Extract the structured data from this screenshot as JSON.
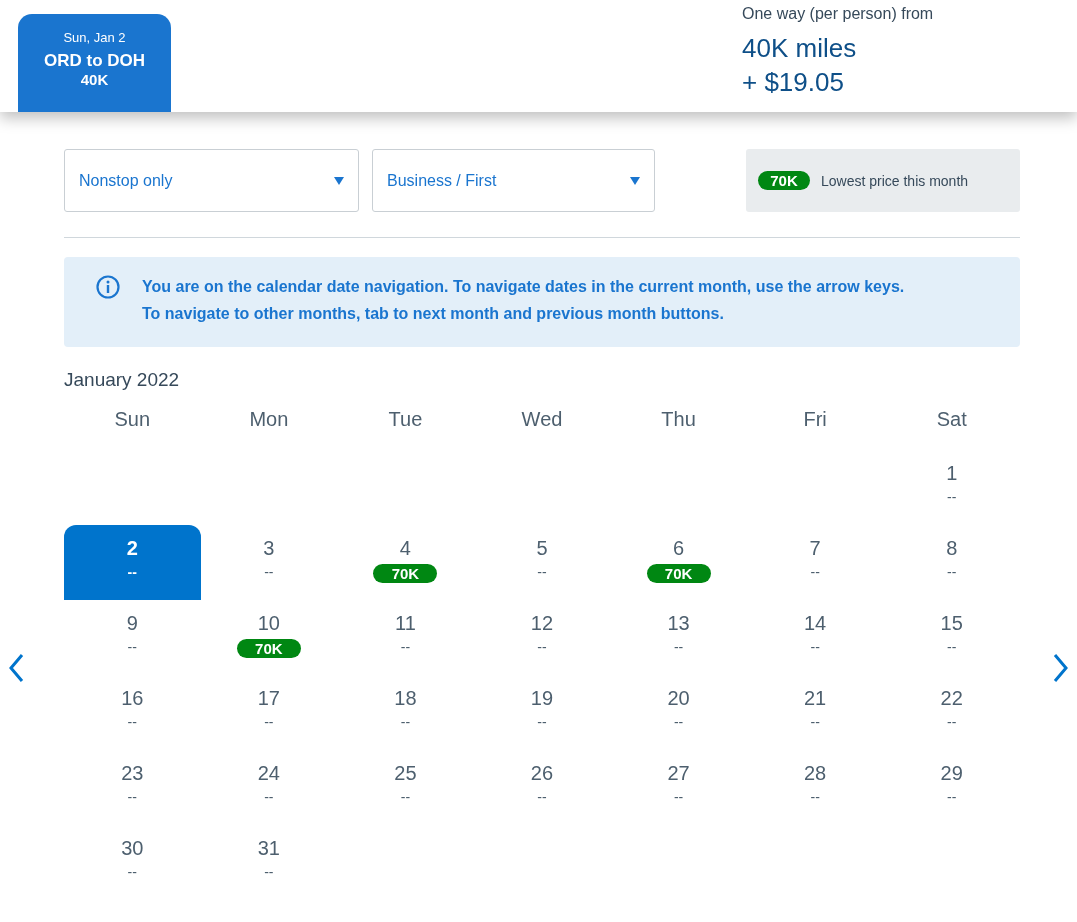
{
  "trip_tab": {
    "date": "Sun, Jan 2",
    "route": "ORD to DOH",
    "price": "40K",
    "selected": true
  },
  "fare": {
    "label": "One way (per person) from",
    "miles": "40K miles",
    "cash": "+ $19.05"
  },
  "filters": [
    {
      "value": "Nonstop only"
    },
    {
      "value": "Business / First"
    }
  ],
  "legend": {
    "badge": "70K",
    "label": "Lowest price this month"
  },
  "info": {
    "text": "You are on the calendar date navigation. To navigate dates in the current month, use the arrow keys. To navigate to other months, tab to next month and previous month buttons."
  },
  "calendar": {
    "month": "January 2022",
    "weekdays": [
      "Sun",
      "Mon",
      "Tue",
      "Wed",
      "Thu",
      "Fri",
      "Sat"
    ],
    "weeks": [
      [
        {
          "day": "1",
          "price": "--",
          "kind": "plain",
          "selected": false
        }
      ],
      [
        {
          "day": "2",
          "price": "--",
          "kind": "plain",
          "selected": true
        },
        {
          "day": "3",
          "price": "--",
          "kind": "plain",
          "selected": false
        },
        {
          "day": "4",
          "price": "70K",
          "kind": "badge",
          "selected": false
        },
        {
          "day": "5",
          "price": "--",
          "kind": "plain",
          "selected": false
        },
        {
          "day": "6",
          "price": "70K",
          "kind": "badge",
          "selected": false
        },
        {
          "day": "7",
          "price": "--",
          "kind": "plain",
          "selected": false
        },
        {
          "day": "8",
          "price": "--",
          "kind": "plain",
          "selected": false
        }
      ],
      [
        {
          "day": "9",
          "price": "--",
          "kind": "plain",
          "selected": false
        },
        {
          "day": "10",
          "price": "70K",
          "kind": "badge",
          "selected": false
        },
        {
          "day": "11",
          "price": "--",
          "kind": "plain",
          "selected": false
        },
        {
          "day": "12",
          "price": "--",
          "kind": "plain",
          "selected": false
        },
        {
          "day": "13",
          "price": "--",
          "kind": "plain",
          "selected": false
        },
        {
          "day": "14",
          "price": "--",
          "kind": "plain",
          "selected": false
        },
        {
          "day": "15",
          "price": "--",
          "kind": "plain",
          "selected": false
        }
      ],
      [
        {
          "day": "16",
          "price": "--",
          "kind": "plain",
          "selected": false
        },
        {
          "day": "17",
          "price": "--",
          "kind": "plain",
          "selected": false
        },
        {
          "day": "18",
          "price": "--",
          "kind": "plain",
          "selected": false
        },
        {
          "day": "19",
          "price": "--",
          "kind": "plain",
          "selected": false
        },
        {
          "day": "20",
          "price": "--",
          "kind": "plain",
          "selected": false
        },
        {
          "day": "21",
          "price": "--",
          "kind": "plain",
          "selected": false
        },
        {
          "day": "22",
          "price": "--",
          "kind": "plain",
          "selected": false
        }
      ],
      [
        {
          "day": "23",
          "price": "--",
          "kind": "plain",
          "selected": false
        },
        {
          "day": "24",
          "price": "--",
          "kind": "plain",
          "selected": false
        },
        {
          "day": "25",
          "price": "--",
          "kind": "plain",
          "selected": false
        },
        {
          "day": "26",
          "price": "--",
          "kind": "plain",
          "selected": false
        },
        {
          "day": "27",
          "price": "--",
          "kind": "plain",
          "selected": false
        },
        {
          "day": "28",
          "price": "--",
          "kind": "plain",
          "selected": false
        },
        {
          "day": "29",
          "price": "--",
          "kind": "plain",
          "selected": false
        }
      ],
      [
        {
          "day": "30",
          "price": "--",
          "kind": "plain",
          "selected": false
        },
        {
          "day": "31",
          "price": "--",
          "kind": "plain",
          "selected": false
        }
      ]
    ]
  }
}
